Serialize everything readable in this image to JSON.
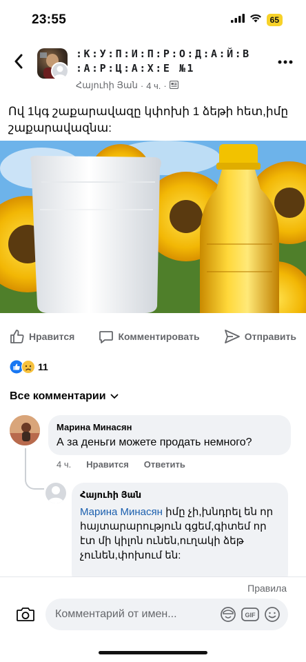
{
  "status_bar": {
    "time": "23:55",
    "battery": "65",
    "icons": [
      "signal-icon",
      "wifi-icon",
      "battery-icon"
    ]
  },
  "post": {
    "group_name": ":К:У:П:И:П:Р:О:Д:А:Й:В :А:Р:Ц:А:Х:Е №1",
    "author": "Հայուհի Յան",
    "time": "4 ч.",
    "text": "Ով 1կգ շաքարավազը կփոխի 1 ձեթի հետ,իմը շաքարավազնա:",
    "image_alt": "sugar-bag-and-sunflower-oil-bottle-photo"
  },
  "actions": {
    "like": "Нравится",
    "comment": "Комментировать",
    "share": "Отправить"
  },
  "reactions": {
    "count": "11",
    "types": [
      "like-reaction-icon",
      "sad-reaction-icon"
    ]
  },
  "comments_header": "Все комментарии",
  "comments": [
    {
      "name": "Марина Минасян",
      "text": "А за деньги  можете  продать  немного?",
      "time": "4 ч.",
      "like": "Нравится",
      "reply": "Ответить"
    },
    {
      "name": "Հայուհի Յան",
      "mention": "Марина Минасян",
      "text": " իմը չի,խնդրել են որ հայտարարություն գցեմ,գիտեմ որ էտ մի կիլոն ունեն,ուղակի ձեթ չունեն,փոխում են:"
    }
  ],
  "bottom": {
    "rules": "Правила",
    "input_placeholder": "Комментарий от имен...",
    "gif_label": "GIF"
  },
  "colors": {
    "accent": "#1877f2",
    "mention": "#1b5fae",
    "muted_text": "#65676b",
    "bubble": "#f0f2f5",
    "battery": "#f7d229"
  }
}
